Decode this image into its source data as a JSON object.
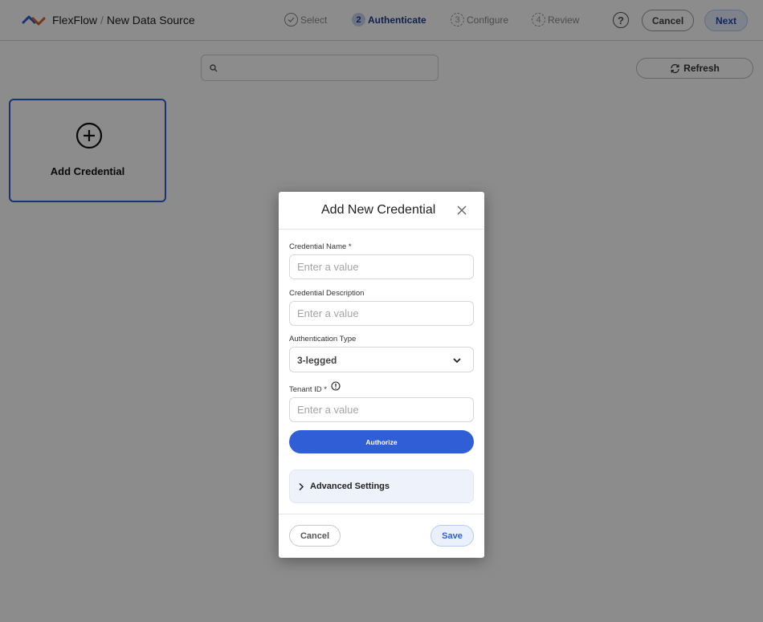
{
  "header": {
    "app_name": "FlexFlow",
    "separator": "/",
    "page_title": "New Data Source",
    "help_icon": "?",
    "cancel_label": "Cancel",
    "next_label": "Next"
  },
  "steps": [
    {
      "number": "✓",
      "label": "Select",
      "state": "done"
    },
    {
      "number": "2",
      "label": "Authenticate",
      "state": "active"
    },
    {
      "number": "3",
      "label": "Configure",
      "state": "todo"
    },
    {
      "number": "4",
      "label": "Review",
      "state": "todo"
    }
  ],
  "toolbar": {
    "search_placeholder": "",
    "search_value": "",
    "refresh_label": "Refresh"
  },
  "cards": {
    "add_credential_label": "Add Credential"
  },
  "modal": {
    "title": "Add New Credential",
    "fields": {
      "name": {
        "label": "Credential Name *",
        "placeholder": "Enter a value",
        "value": ""
      },
      "description": {
        "label": "Credential Description",
        "placeholder": "Enter a value",
        "value": ""
      },
      "auth_type": {
        "label": "Authentication Type",
        "value": "3-legged"
      },
      "tenant_id": {
        "label": "Tenant ID *",
        "placeholder": "Enter a value",
        "value": ""
      }
    },
    "authorize_label": "Authorize",
    "advanced_label": "Advanced Settings",
    "cancel_label": "Cancel",
    "save_label": "Save"
  },
  "colors": {
    "accent": "#2f5ed6",
    "logo_blue": "#2f5fcf",
    "logo_orange": "#d9622b",
    "active_step": "#1a3b8f"
  }
}
